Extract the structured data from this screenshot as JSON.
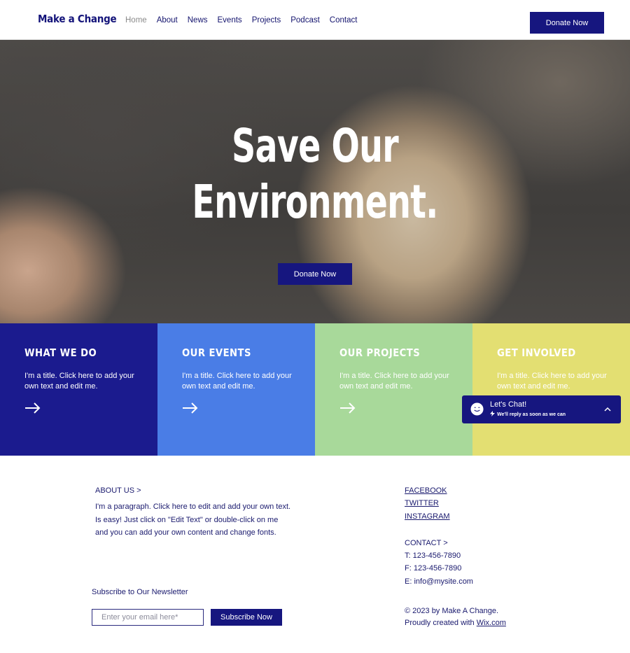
{
  "header": {
    "logo": "Make a Change",
    "nav": [
      "Home",
      "About",
      "News",
      "Events",
      "Projects",
      "Podcast",
      "Contact"
    ],
    "donate_label": "Donate Now"
  },
  "hero": {
    "title_line1": "Save Our",
    "title_line2": "Environment.",
    "donate_label": "Donate Now"
  },
  "tiles": [
    {
      "heading": "WHAT WE DO",
      "text": "I'm a title. Click here to add your own text and edit me.",
      "color": "#1b1b8e",
      "text_color": "#ffffff"
    },
    {
      "heading": "OUR EVENTS",
      "text": "I'm a title. Click here to add your own text and edit me.",
      "color": "#4a7de6",
      "text_color": "#ffffff"
    },
    {
      "heading": "OUR PROJECTS",
      "text": "I'm a title. Click here to add your own text and edit me.",
      "color": "#a8d99a",
      "text_color": "#ffffff"
    },
    {
      "heading": "GET INVOLVED",
      "text": "I'm a title. Click here to add your own text and edit me.",
      "color": "#e3df72",
      "text_color": "#ffffff"
    }
  ],
  "chat": {
    "title": "Let's Chat!",
    "subtitle": "We'll reply as soon as we can"
  },
  "footer": {
    "about_heading": "ABOUT US >",
    "about_lines": [
      "I'm a paragraph. Click here to edit and add your own text.",
      "Is easy! Just click on \"Edit Text\" or double-click on me",
      "and you can add your own content and change fonts."
    ],
    "newsletter_label": "Subscribe to Our Newsletter",
    "email_placeholder": "Enter your email here*",
    "subscribe_label": "Subscribe Now",
    "social": [
      "FACEBOOK",
      "TWITTER",
      "INSTAGRAM"
    ],
    "contact_heading": "CONTACT >",
    "phone": "T: 123-456-7890",
    "fax": "F: 123-456-7890",
    "email": "E: info@mysite.com",
    "copyright": "© 2023 by Make A Change.",
    "created_prefix": "Proudly created with ",
    "created_link": "Wix.com"
  },
  "colors": {
    "brand": "#16167f",
    "text": "#1a1a6e",
    "nav_active": "#8a8a8a"
  }
}
